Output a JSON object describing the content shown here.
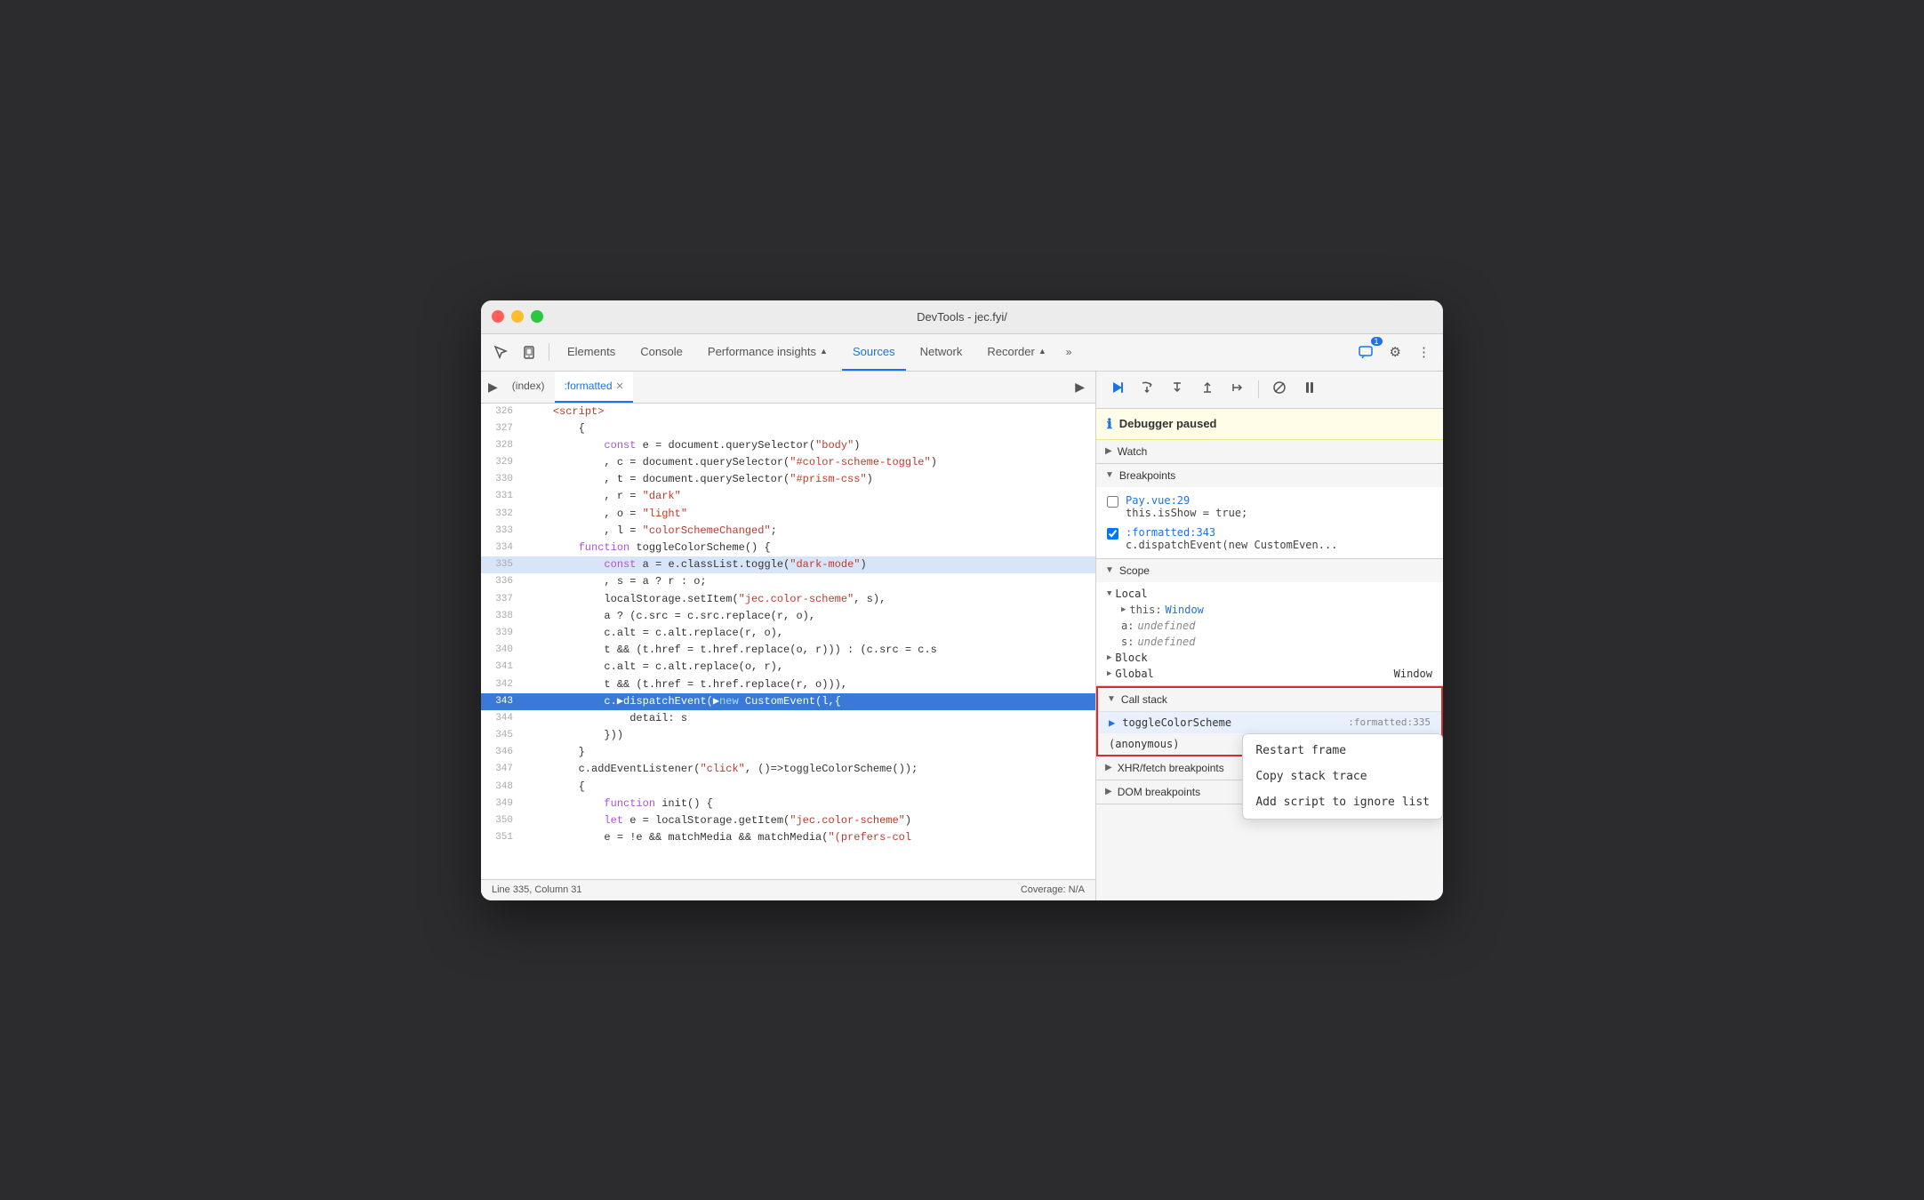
{
  "window": {
    "title": "DevTools - jec.fyi/"
  },
  "titlebar": {
    "close": "●",
    "minimize": "●",
    "maximize": "●"
  },
  "toolbar": {
    "tabs": [
      {
        "id": "elements",
        "label": "Elements",
        "active": false
      },
      {
        "id": "console",
        "label": "Console",
        "active": false
      },
      {
        "id": "performance",
        "label": "Performance insights",
        "active": false,
        "icon": "▲"
      },
      {
        "id": "sources",
        "label": "Sources",
        "active": true
      },
      {
        "id": "network",
        "label": "Network",
        "active": false
      },
      {
        "id": "recorder",
        "label": "Recorder",
        "active": false,
        "icon": "▲"
      }
    ],
    "more_label": "»",
    "chat_badge": "1",
    "settings_icon": "⚙",
    "overflow_icon": "⋮"
  },
  "editor": {
    "tabs": [
      {
        "id": "index",
        "label": "(index)",
        "active": false,
        "closeable": false
      },
      {
        "id": "formatted",
        "label": ":formatted",
        "active": true,
        "closeable": true
      }
    ],
    "lines": [
      {
        "num": 326,
        "content": "    <script>",
        "type": "tag"
      },
      {
        "num": 327,
        "content": "        {",
        "type": "normal"
      },
      {
        "num": 328,
        "content": "            const e = document.querySelector(\"body\")",
        "type": "code"
      },
      {
        "num": 329,
        "content": "            , c = document.querySelector(\"#color-scheme-toggle\")",
        "type": "code"
      },
      {
        "num": 330,
        "content": "            , t = document.querySelector(\"#prism-css\")",
        "type": "code"
      },
      {
        "num": 331,
        "content": "            , r = \"dark\"",
        "type": "code"
      },
      {
        "num": 332,
        "content": "            , o = \"light\"",
        "type": "code"
      },
      {
        "num": 333,
        "content": "            , l = \"colorSchemeChanged\";",
        "type": "code"
      },
      {
        "num": 334,
        "content": "        function toggleColorScheme() {",
        "type": "code"
      },
      {
        "num": 335,
        "content": "            const a = e.classList.toggle(\"dark-mode\")",
        "type": "code",
        "highlighted": true
      },
      {
        "num": 336,
        "content": "            , s = a ? r : o;",
        "type": "code"
      },
      {
        "num": 337,
        "content": "            localStorage.setItem(\"jec.color-scheme\", s),",
        "type": "code"
      },
      {
        "num": 338,
        "content": "            a ? (c.src = c.src.replace(r, o),",
        "type": "code"
      },
      {
        "num": 339,
        "content": "            c.alt = c.alt.replace(r, o),",
        "type": "code"
      },
      {
        "num": 340,
        "content": "            t && (t.href = t.href.replace(o, r))) : (c.src = c.s",
        "type": "code"
      },
      {
        "num": 341,
        "content": "            c.alt = c.alt.replace(o, r),",
        "type": "code"
      },
      {
        "num": 342,
        "content": "            t && (t.href = t.href.replace(r, o))),",
        "type": "code"
      },
      {
        "num": 343,
        "content": "            c.dispatchEvent(new CustomEvent(l,{",
        "type": "code",
        "active": true
      },
      {
        "num": 344,
        "content": "                detail: s",
        "type": "code"
      },
      {
        "num": 345,
        "content": "            }))",
        "type": "code"
      },
      {
        "num": 346,
        "content": "        }",
        "type": "code"
      },
      {
        "num": 347,
        "content": "        c.addEventListener(\"click\", ()=>toggleColorScheme());",
        "type": "code"
      },
      {
        "num": 348,
        "content": "        {",
        "type": "code"
      },
      {
        "num": 349,
        "content": "            function init() {",
        "type": "code"
      },
      {
        "num": 350,
        "content": "            let e = localStorage.getItem(\"jec.color-scheme\")",
        "type": "code"
      },
      {
        "num": 351,
        "content": "            e = !e && matchMedia && matchMedia(\"(prefers-col",
        "type": "code"
      }
    ]
  },
  "statusbar": {
    "position": "Line 335, Column 31",
    "coverage": "Coverage: N/A"
  },
  "debugger": {
    "paused_label": "Debugger paused",
    "toolbar_buttons": [
      {
        "id": "resume",
        "icon": "▶",
        "title": "Resume"
      },
      {
        "id": "step-over",
        "icon": "↺",
        "title": "Step over"
      },
      {
        "id": "step-into",
        "icon": "↓",
        "title": "Step into"
      },
      {
        "id": "step-out",
        "icon": "↑",
        "title": "Step out"
      },
      {
        "id": "step",
        "icon": "⇥",
        "title": "Step"
      },
      {
        "id": "deactivate",
        "icon": "✎",
        "title": "Deactivate breakpoints"
      },
      {
        "id": "pause-exceptions",
        "icon": "⏸",
        "title": "Pause on exceptions"
      }
    ],
    "sections": {
      "watch": {
        "label": "Watch",
        "expanded": false
      },
      "breakpoints": {
        "label": "Breakpoints",
        "expanded": true,
        "items": [
          {
            "checked": false,
            "location": "Pay.vue:29",
            "code": "this.isShow = true;"
          },
          {
            "checked": true,
            "location": ":formatted:343",
            "code": "c.dispatchEvent(new CustomEven..."
          }
        ]
      },
      "scope": {
        "label": "Scope",
        "expanded": true,
        "local": {
          "label": "Local",
          "items": [
            {
              "key": "this",
              "value": "Window",
              "expandable": true
            },
            {
              "key": "a:",
              "value": "undefined"
            },
            {
              "key": "s:",
              "value": "undefined"
            }
          ]
        },
        "block": {
          "label": "Block",
          "expandable": true
        },
        "global": {
          "label": "Global",
          "value": "Window",
          "expandable": true
        }
      },
      "call_stack": {
        "label": "Call stack",
        "expanded": true,
        "items": [
          {
            "fn": "toggleColorScheme",
            "location": ":formatted:335",
            "current": true
          },
          {
            "fn": "(anonymous)",
            "location": "",
            "current": false
          }
        ]
      }
    },
    "context_menu": {
      "items": [
        {
          "id": "restart-frame",
          "label": "Restart frame"
        },
        {
          "id": "copy-stack-trace",
          "label": "Copy stack trace"
        },
        {
          "id": "add-to-ignore",
          "label": "Add script to ignore list"
        }
      ]
    },
    "xhr_breakpoints": {
      "label": "XHR/fetch breakpoints",
      "expanded": false
    },
    "dom_breakpoints": {
      "label": "DOM breakpoints",
      "expanded": false
    }
  }
}
